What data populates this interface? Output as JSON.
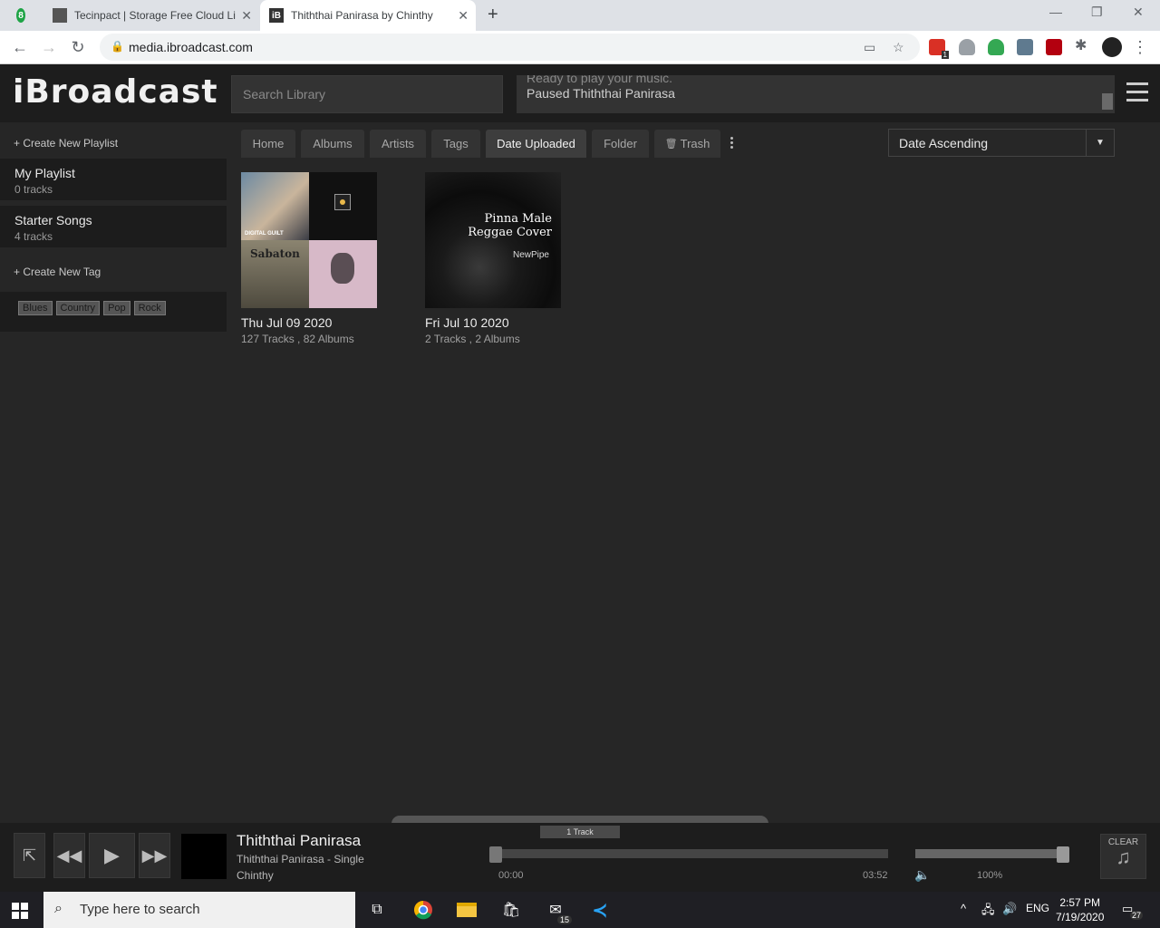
{
  "browser": {
    "tabs": [
      {
        "title": "Tecinpact | Storage Free Cloud Li",
        "active": false
      },
      {
        "title": "Thiththai Panirasa by Chinthy",
        "active": true
      }
    ],
    "tab_badge": "8",
    "url": "media.ibroadcast.com",
    "ext_badge": "1"
  },
  "app": {
    "logo": "iBroadcast",
    "search_placeholder": "Search Library",
    "status_prev": "Ready to play your music.",
    "status_current": "Paused Thiththai Panirasa"
  },
  "sidebar": {
    "create_playlist": "+ Create New Playlist",
    "playlists": [
      {
        "name": "My Playlist",
        "count": "0 tracks"
      },
      {
        "name": "Starter Songs",
        "count": "4 tracks"
      }
    ],
    "create_tag": "+ Create New Tag",
    "tags": [
      "Blues",
      "Country",
      "Pop",
      "Rock"
    ]
  },
  "nav": {
    "tabs": [
      "Home",
      "Albums",
      "Artists",
      "Tags",
      "Date Uploaded",
      "Folder",
      "Trash"
    ],
    "active": "Date Uploaded",
    "sort": "Date Ascending"
  },
  "grid": [
    {
      "date": "Thu Jul 09 2020",
      "summary": "127 Tracks , 82 Albums",
      "art_labels": [
        "DIGITAL GUILT",
        "Sabaton"
      ]
    },
    {
      "date": "Fri Jul 10 2020",
      "summary": "2 Tracks , 2 Albums",
      "art_title": "Pinna Male Reggae Cover",
      "art_sub": "NewPipe"
    }
  ],
  "player": {
    "queue_count": "1 Track",
    "title": "Thiththai Panirasa",
    "album": "Thiththai Panirasa - Single",
    "artist": "Chinthy",
    "time_start": "00:00",
    "time_end": "03:52",
    "volume": "100%",
    "clear_label": "CLEAR",
    "progress_fraction": 0.0,
    "volume_fraction": 1.0
  },
  "taskbar": {
    "search_placeholder": "Type here to search",
    "mail_badge": "15",
    "lang": "ENG",
    "time": "2:57 PM",
    "date": "7/19/2020",
    "notif_count": "27"
  },
  "colors": {
    "chrome_accent": "#1a73e8",
    "app_bg": "#262626",
    "header_bg": "#1d1d1d"
  }
}
